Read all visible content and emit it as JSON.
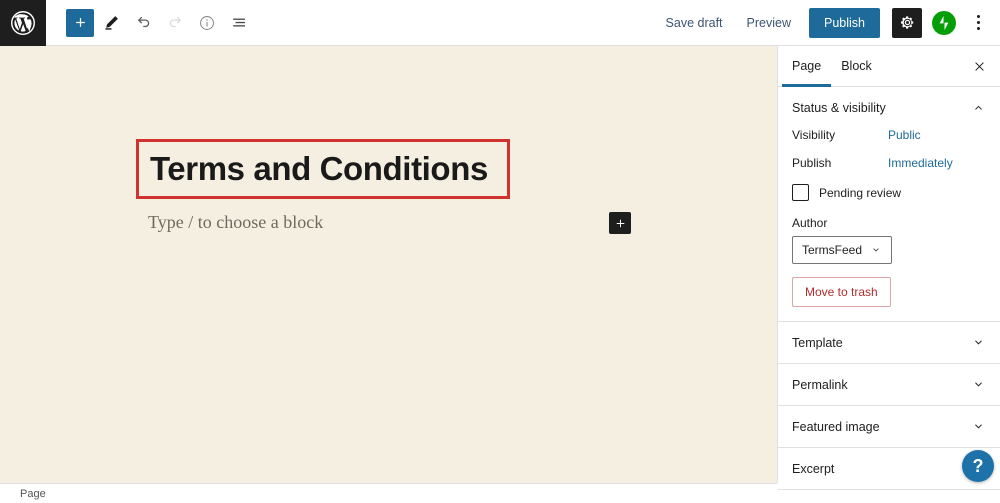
{
  "topbar": {
    "logo_icon": "wordpress-logo-icon",
    "tools": [
      {
        "name": "add-block-button",
        "icon": "plus-icon",
        "state": "primary"
      },
      {
        "name": "tools-button",
        "icon": "pencil-icon",
        "state": "normal"
      },
      {
        "name": "undo-button",
        "icon": "undo-arrow-icon",
        "state": "normal"
      },
      {
        "name": "redo-button",
        "icon": "redo-arrow-icon",
        "state": "disabled"
      },
      {
        "name": "details-button",
        "icon": "info-circle-icon",
        "state": "normal"
      },
      {
        "name": "list-view-button",
        "icon": "list-view-icon",
        "state": "normal"
      }
    ],
    "save_draft_label": "Save draft",
    "preview_label": "Preview",
    "publish_label": "Publish",
    "settings_icon": "gear-icon",
    "jetpack_icon": "jetpack-bolt-icon",
    "more_options_icon": "kebab-menu-icon"
  },
  "canvas": {
    "post_title": "Terms and Conditions",
    "block_placeholder": "Type / to choose a block",
    "inserter_icon": "plus-icon",
    "annotation_color": "#d0322e",
    "background_color": "#f5efe2"
  },
  "bottombar": {
    "breadcrumb": "Page"
  },
  "sidebar": {
    "tabs": [
      {
        "label": "Page",
        "active": true
      },
      {
        "label": "Block",
        "active": false
      }
    ],
    "close_icon": "close-x-icon",
    "accent_color": "#1e6a9a",
    "status_panel": {
      "title": "Status & visibility",
      "chevron": "chevron-up-icon",
      "visibility_label": "Visibility",
      "visibility_value": "Public",
      "publish_label": "Publish",
      "publish_value": "Immediately",
      "pending_review_label": "Pending review",
      "author_label": "Author",
      "author_value": "TermsFeed",
      "author_chevron": "chevron-down-icon",
      "trash_label": "Move to trash",
      "trash_color": "#b32d2e"
    },
    "panels": [
      {
        "title": "Template",
        "chevron": "chevron-down-icon"
      },
      {
        "title": "Permalink",
        "chevron": "chevron-down-icon"
      },
      {
        "title": "Featured image",
        "chevron": "chevron-down-icon"
      },
      {
        "title": "Excerpt",
        "chevron": "chevron-down-icon"
      }
    ]
  },
  "help": {
    "label": "?",
    "icon": "question-mark-icon"
  }
}
